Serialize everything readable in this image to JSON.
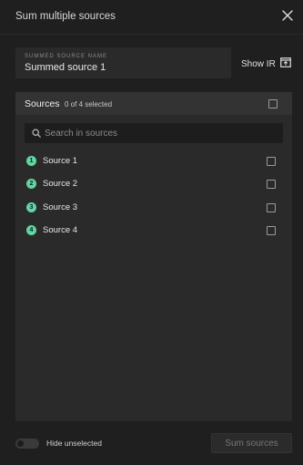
{
  "dialog": {
    "title": "Sum multiple sources",
    "close_icon": "close-icon"
  },
  "summed_source": {
    "label": "SUMMED SOURCE NAME",
    "value": "Summed source 1"
  },
  "show_ir": {
    "label": "Show IR",
    "icon": "open-panel-icon"
  },
  "sources_panel": {
    "title": "Sources",
    "selected_count": "0 of 4 selected",
    "search_placeholder": "Search in sources",
    "items": [
      {
        "number": "1",
        "label": "Source 1",
        "checked": false
      },
      {
        "number": "2",
        "label": "Source 2",
        "checked": false
      },
      {
        "number": "3",
        "label": "Source 3",
        "checked": false
      },
      {
        "number": "4",
        "label": "Source 4",
        "checked": false
      }
    ]
  },
  "footer": {
    "toggle_label": "Hide unselected",
    "toggle_on": false,
    "sum_button": "Sum sources"
  },
  "colors": {
    "accent": "#5fd6a3",
    "background": "#1f1f1f",
    "panel": "#2a2a2a"
  }
}
